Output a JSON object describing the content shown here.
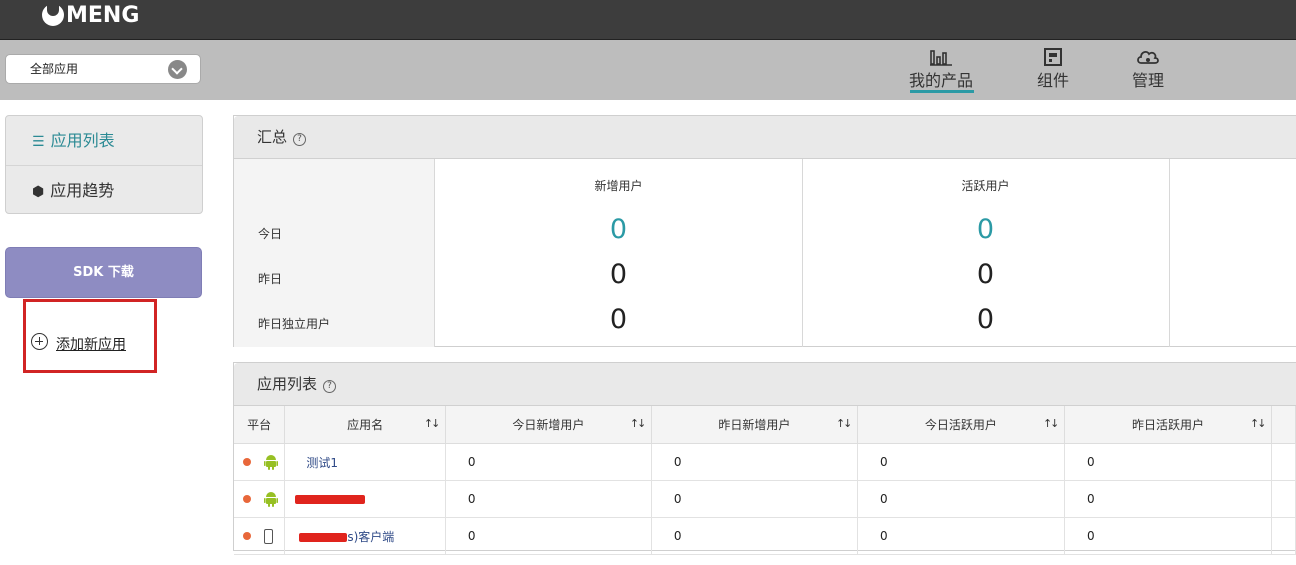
{
  "header": {
    "logo": "MENG"
  },
  "app_selector": {
    "value": "全部应用"
  },
  "top_nav": [
    {
      "label": "我的产品",
      "icon": "bar-chart-icon",
      "active": true
    },
    {
      "label": "组件",
      "icon": "component-icon",
      "active": false
    },
    {
      "label": "管理",
      "icon": "cloud-gear-icon",
      "active": false
    }
  ],
  "sidebar": {
    "items": [
      {
        "label": "应用列表",
        "icon": "list-icon",
        "active": true
      },
      {
        "label": "应用趋势",
        "icon": "cube-icon",
        "active": false
      }
    ],
    "sdk_button": "SDK 下载",
    "add_app": "添加新应用"
  },
  "summary": {
    "title": "汇总",
    "help": "?",
    "row_labels": [
      "今日",
      "昨日",
      "昨日独立用户"
    ],
    "columns": [
      {
        "header": "新增用户",
        "values": [
          "0",
          "0",
          "0"
        ]
      },
      {
        "header": "活跃用户",
        "values": [
          "0",
          "0",
          "0"
        ]
      }
    ]
  },
  "app_list": {
    "title": "应用列表",
    "help": "?",
    "columns": [
      "平台",
      "应用名",
      "今日新增用户",
      "昨日新增用户",
      "今日活跃用户",
      "昨日活跃用户"
    ],
    "sort_glyph": "↑↓",
    "rows": [
      {
        "platform": "android-icon",
        "name": "测试1",
        "today_new": "0",
        "yesterday_new": "0",
        "today_active": "0",
        "yesterday_active": "0"
      },
      {
        "platform": "android-icon",
        "name": "",
        "today_new": "0",
        "yesterday_new": "0",
        "today_active": "0",
        "yesterday_active": "0"
      },
      {
        "platform": "phone-icon",
        "name": "s)客户端",
        "today_new": "0",
        "yesterday_new": "0",
        "today_active": "0",
        "yesterday_active": "0"
      }
    ]
  },
  "colors": {
    "accent": "#2b9aa5",
    "sdk_button": "#8e8cc2",
    "highlight_box": "#d12424",
    "status_dot": "#e8673a",
    "android_green": "#97c024"
  }
}
